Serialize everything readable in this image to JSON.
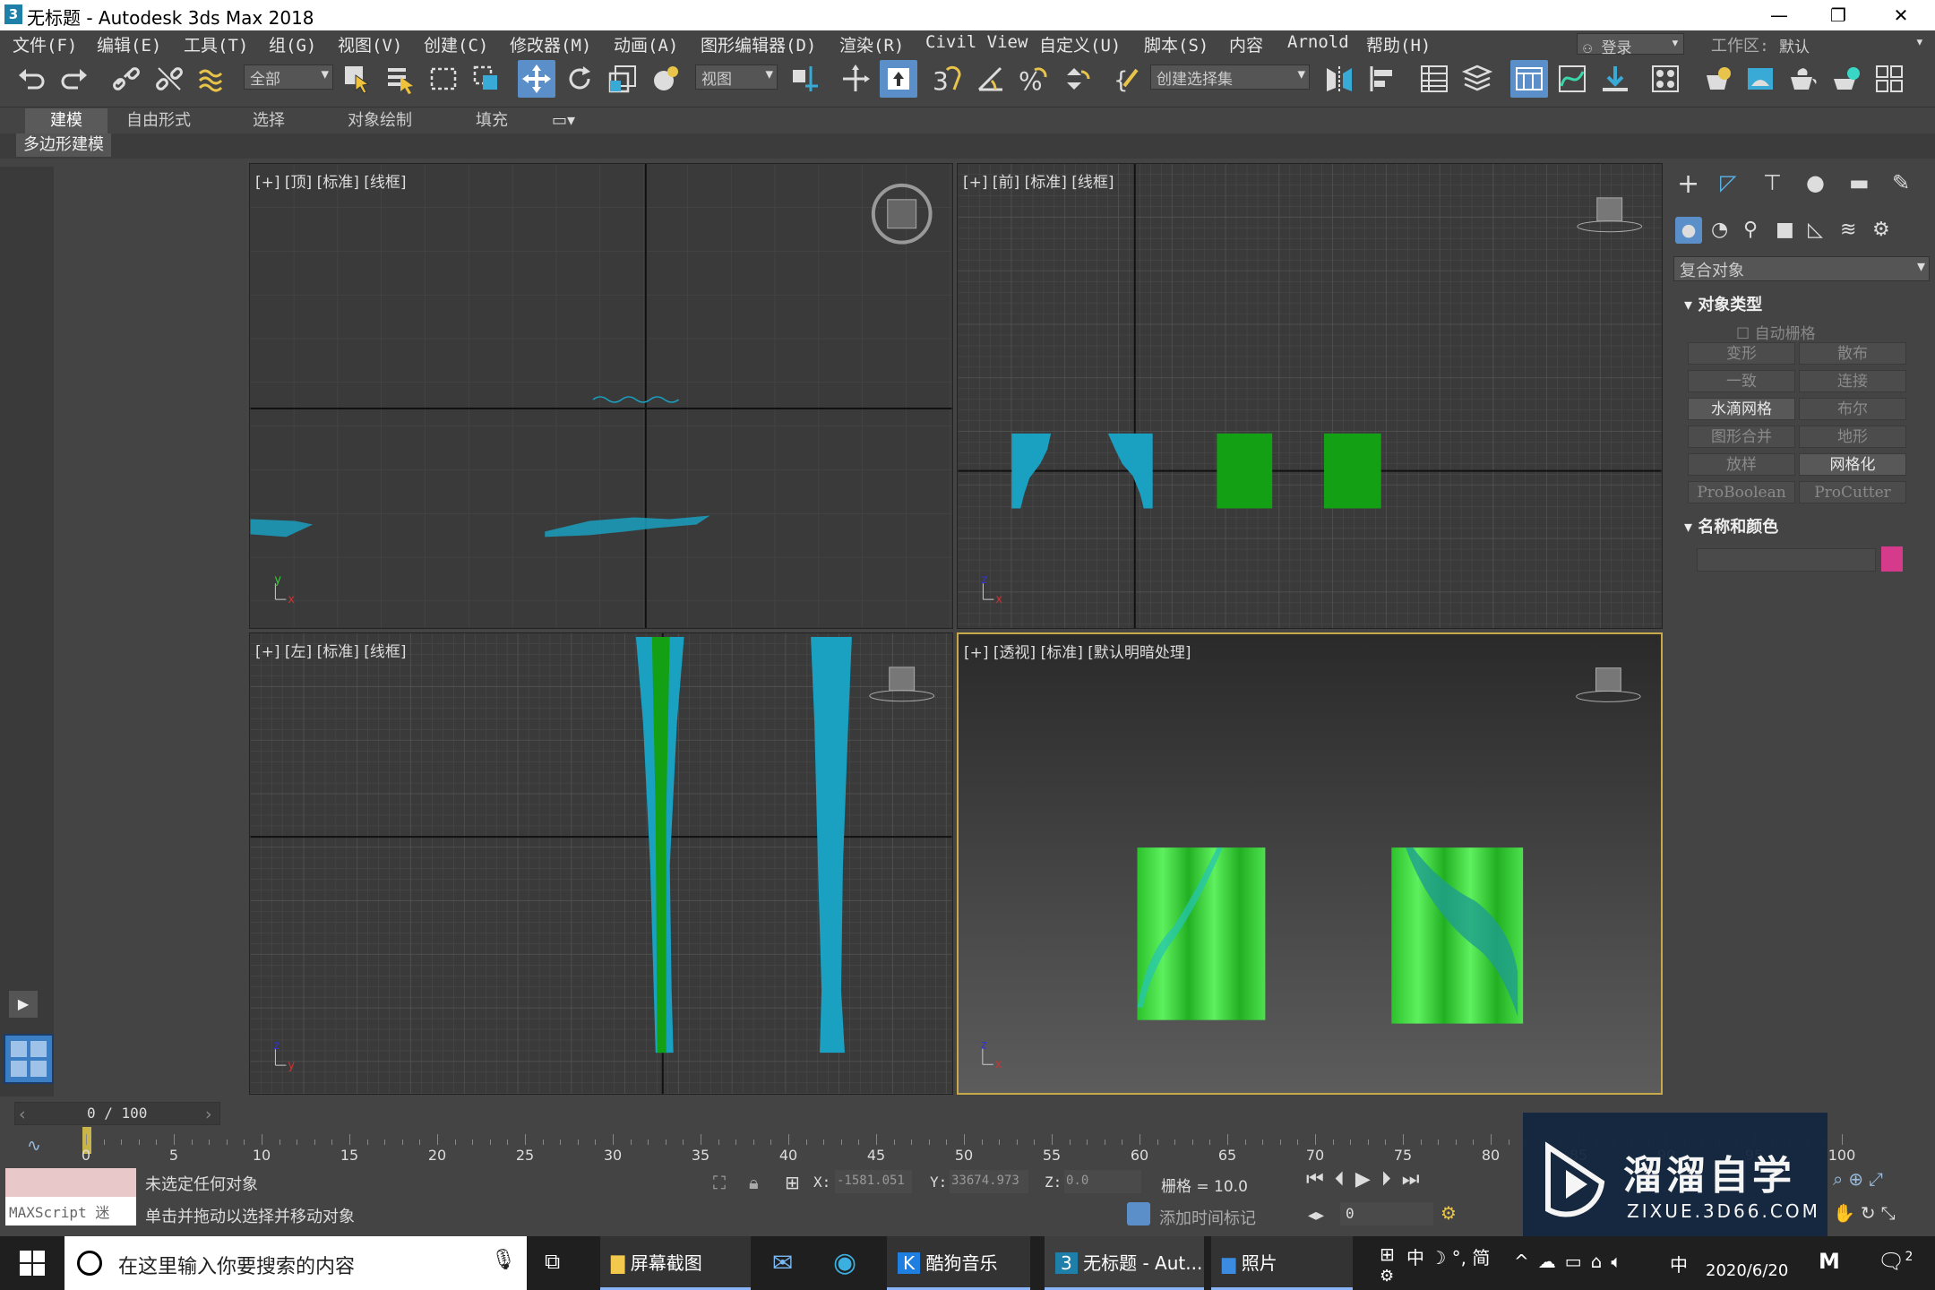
{
  "window": {
    "title": "无标题 - Autodesk 3ds Max 2018",
    "app_icon": "3",
    "minimize": "—",
    "restore": "❐",
    "close": "✕"
  },
  "menu": {
    "items": [
      "文件(F)",
      "编辑(E)",
      "工具(T)",
      "组(G)",
      "视图(V)",
      "创建(C)",
      "修改器(M)",
      "动画(A)",
      "图形编辑器(D)",
      "渲染(R)",
      "Civil View",
      "自定义(U)",
      "脚本(S)",
      "内容",
      "Arnold",
      "帮助(H)"
    ],
    "login": "登录",
    "workspace_label": "工作区:",
    "workspace_value": "默认"
  },
  "toolbar": {
    "filter_value": "全部",
    "refcoord_value": "视图",
    "named_sel_value": "创建选择集",
    "snap_label": "3"
  },
  "ribbon": {
    "tabs": [
      "建模",
      "自由形式",
      "选择",
      "对象绘制",
      "填充"
    ],
    "active": 0,
    "sub_label": "多边形建模"
  },
  "viewports": {
    "top": {
      "label": "[+] [顶] [标准] [线框]"
    },
    "front": {
      "label": "[+] [前] [标准] [线框]"
    },
    "left": {
      "label": "[+] [左] [标准] [线框]"
    },
    "persp": {
      "label": "[+] [透视] [标准] [默认明暗处理]"
    }
  },
  "command_panel": {
    "category": "复合对象",
    "rollout_type": "对象类型",
    "autogrid": "自动栅格",
    "buttons": [
      {
        "label": "变形",
        "enabled": false
      },
      {
        "label": "散布",
        "enabled": false
      },
      {
        "label": "一致",
        "enabled": false
      },
      {
        "label": "连接",
        "enabled": false
      },
      {
        "label": "水滴网格",
        "enabled": true
      },
      {
        "label": "布尔",
        "enabled": false
      },
      {
        "label": "图形合并",
        "enabled": false
      },
      {
        "label": "地形",
        "enabled": false
      },
      {
        "label": "放样",
        "enabled": false
      },
      {
        "label": "网格化",
        "enabled": true
      },
      {
        "label": "ProBoolean",
        "enabled": false
      },
      {
        "label": "ProCutter",
        "enabled": false
      }
    ],
    "rollout_name": "名称和颜色",
    "object_color": "#d63a8a"
  },
  "timeline": {
    "frame_display": "0 / 100",
    "ticks": [
      "0",
      "5",
      "10",
      "15",
      "20",
      "25",
      "30",
      "35",
      "40",
      "45",
      "50",
      "55",
      "60",
      "65",
      "70",
      "75",
      "80",
      "85",
      "90",
      "95",
      "100"
    ]
  },
  "status": {
    "maxscript_label": "MAXScript 迷",
    "line1": "未选定任何对象",
    "line2": "单击并拖动以选择并移动对象",
    "x_label": "X:",
    "x_value": "-1581.051",
    "y_label": "Y:",
    "y_value": "33674.973",
    "z_label": "Z:",
    "z_value": "0.0",
    "grid_label": "栅格 = 10.0",
    "add_tag": "添加时间标记",
    "frame_field": "0"
  },
  "taskbar": {
    "search_placeholder": "在这里输入你要搜索的内容",
    "apps": [
      "屏幕截图",
      "酷狗音乐",
      "无标题 - Aut...",
      "照片"
    ],
    "ime": "中 ☽ °, 简",
    "tray_ime": "中",
    "date": "2020/6/20",
    "notif_count": "2"
  },
  "watermark": {
    "title": "溜溜自学",
    "url": "ZIXUE.3D66.COM"
  },
  "colors": {
    "curtain_blue": "#1aa0c0",
    "curtain_green": "#14a014",
    "persp_green": "#3bd13b",
    "viewport_border_active": "#c8a94a"
  }
}
